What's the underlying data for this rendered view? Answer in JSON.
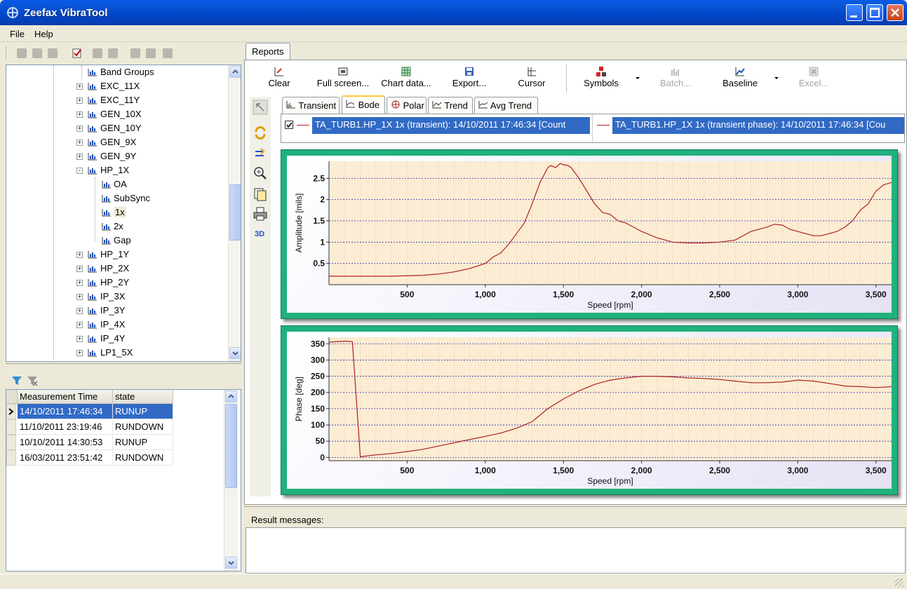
{
  "window": {
    "title": "Zeefax VibraTool"
  },
  "menu": {
    "file": "File",
    "help": "Help"
  },
  "tree": {
    "items": [
      {
        "label": "Band Groups",
        "level": 2,
        "expander": ""
      },
      {
        "label": "EXC_11X",
        "level": 1,
        "expander": "+"
      },
      {
        "label": "EXC_11Y",
        "level": 1,
        "expander": "+"
      },
      {
        "label": "GEN_10X",
        "level": 1,
        "expander": "+"
      },
      {
        "label": "GEN_10Y",
        "level": 1,
        "expander": "+"
      },
      {
        "label": "GEN_9X",
        "level": 1,
        "expander": "+"
      },
      {
        "label": "GEN_9Y",
        "level": 1,
        "expander": "+"
      },
      {
        "label": "HP_1X",
        "level": 1,
        "expander": "-"
      },
      {
        "label": "OA",
        "level": 2,
        "expander": ""
      },
      {
        "label": "SubSync",
        "level": 2,
        "expander": ""
      },
      {
        "label": "1x",
        "level": 2,
        "expander": "",
        "selected": true
      },
      {
        "label": "2x",
        "level": 2,
        "expander": ""
      },
      {
        "label": "Gap",
        "level": 2,
        "expander": ""
      },
      {
        "label": "HP_1Y",
        "level": 1,
        "expander": "+"
      },
      {
        "label": "HP_2X",
        "level": 1,
        "expander": "+"
      },
      {
        "label": "HP_2Y",
        "level": 1,
        "expander": "+"
      },
      {
        "label": "IP_3X",
        "level": 1,
        "expander": "+"
      },
      {
        "label": "IP_3Y",
        "level": 1,
        "expander": "+"
      },
      {
        "label": "IP_4X",
        "level": 1,
        "expander": "+"
      },
      {
        "label": "IP_4Y",
        "level": 1,
        "expander": "+"
      },
      {
        "label": "LP1_5X",
        "level": 1,
        "expander": "+"
      }
    ]
  },
  "measurements": {
    "headers": [
      "Measurement Time",
      "state"
    ],
    "rows": [
      {
        "time": "14/10/2011 17:46:34",
        "state": "RUNUP",
        "selected": true
      },
      {
        "time": "11/10/2011 23:19:46",
        "state": "RUNDOWN"
      },
      {
        "time": "10/10/2011 14:30:53",
        "state": "RUNUP"
      },
      {
        "time": "16/03/2011 23:51:42",
        "state": "RUNDOWN"
      }
    ]
  },
  "reports": {
    "tab": "Reports",
    "toolbar": {
      "clear": "Clear",
      "fullscreen": "Full screen...",
      "chartdata": "Chart data...",
      "export": "Export...",
      "cursor": "Cursor",
      "symbols": "Symbols",
      "batch": "Batch...",
      "baseline": "Baseline",
      "excel": "Excel..."
    },
    "left_3d": "3D",
    "chart_tabs": [
      "Transient",
      "Bode",
      "Polar",
      "Trend",
      "Avg Trend"
    ],
    "active_tab": "Bode",
    "legend": [
      "TA_TURB1.HP_1X 1x (transient): 14/10/2011 17:46:34 [Count",
      "TA_TURB1.HP_1X 1x (transient phase): 14/10/2011 17:46:34 [Cou"
    ],
    "result_label": "Result messages:"
  },
  "colors": {
    "series": "#b02020",
    "frame": "#20b27c",
    "plot_bg": "#fbecd3",
    "selection": "#316ac5"
  },
  "chart_data": [
    {
      "type": "line",
      "xlabel": "Speed [rpm]",
      "ylabel": "Amplitude [mils]",
      "xlim": [
        0,
        3600
      ],
      "ylim": [
        0,
        2.9
      ],
      "xticks": [
        500,
        1000,
        1500,
        2000,
        2500,
        3000,
        3500
      ],
      "xtick_labels": [
        "500",
        "1,000",
        "1,500",
        "2,000",
        "2,500",
        "3,000",
        "3,500"
      ],
      "yticks": [
        0.5,
        1,
        1.5,
        2,
        2.5
      ],
      "ytick_labels": [
        "0.5",
        "1",
        "1.5",
        "2",
        "2.5"
      ],
      "series": [
        {
          "x": [
            0,
            200,
            400,
            600,
            700,
            800,
            900,
            1000,
            1050,
            1100,
            1150,
            1200,
            1250,
            1300,
            1350,
            1400,
            1420,
            1450,
            1480,
            1500,
            1530,
            1550,
            1600,
            1650,
            1700,
            1750,
            1800,
            1850,
            1900,
            2000,
            2100,
            2200,
            2300,
            2400,
            2500,
            2600,
            2700,
            2800,
            2850,
            2900,
            2950,
            3000,
            3050,
            3100,
            3150,
            3200,
            3250,
            3300,
            3350,
            3400,
            3450,
            3500,
            3550,
            3600
          ],
          "y": [
            0.2,
            0.2,
            0.2,
            0.22,
            0.25,
            0.3,
            0.38,
            0.5,
            0.65,
            0.75,
            0.95,
            1.2,
            1.45,
            1.9,
            2.4,
            2.75,
            2.8,
            2.75,
            2.85,
            2.82,
            2.8,
            2.75,
            2.5,
            2.2,
            1.9,
            1.7,
            1.65,
            1.5,
            1.45,
            1.25,
            1.1,
            1.0,
            0.98,
            0.98,
            1.0,
            1.05,
            1.25,
            1.35,
            1.42,
            1.4,
            1.3,
            1.25,
            1.2,
            1.15,
            1.15,
            1.2,
            1.25,
            1.35,
            1.5,
            1.75,
            1.9,
            2.2,
            2.35,
            2.4
          ]
        }
      ]
    },
    {
      "type": "line",
      "xlabel": "Speed [rpm]",
      "ylabel": "Phase [deg]",
      "xlim": [
        0,
        3600
      ],
      "ylim": [
        -10,
        370
      ],
      "xticks": [
        500,
        1000,
        1500,
        2000,
        2500,
        3000,
        3500
      ],
      "xtick_labels": [
        "500",
        "1,000",
        "1,500",
        "2,000",
        "2,500",
        "3,000",
        "3,500"
      ],
      "yticks": [
        0,
        50,
        100,
        150,
        200,
        250,
        300,
        350
      ],
      "ytick_labels": [
        "0",
        "50",
        "100",
        "150",
        "200",
        "250",
        "300",
        "350"
      ],
      "series": [
        {
          "x": [
            0,
            100,
            120,
            150,
            200,
            300,
            400,
            500,
            600,
            700,
            800,
            900,
            1000,
            1100,
            1200,
            1300,
            1400,
            1500,
            1600,
            1700,
            1800,
            1900,
            2000,
            2100,
            2200,
            2300,
            2400,
            2500,
            2600,
            2700,
            2800,
            2900,
            3000,
            3100,
            3200,
            3300,
            3400,
            3500,
            3600
          ],
          "y": [
            355,
            358,
            358,
            356,
            2,
            8,
            12,
            18,
            25,
            35,
            45,
            55,
            65,
            75,
            90,
            110,
            150,
            180,
            205,
            225,
            238,
            245,
            250,
            250,
            248,
            245,
            243,
            240,
            235,
            230,
            230,
            232,
            238,
            235,
            228,
            220,
            218,
            215,
            218
          ]
        }
      ]
    }
  ]
}
